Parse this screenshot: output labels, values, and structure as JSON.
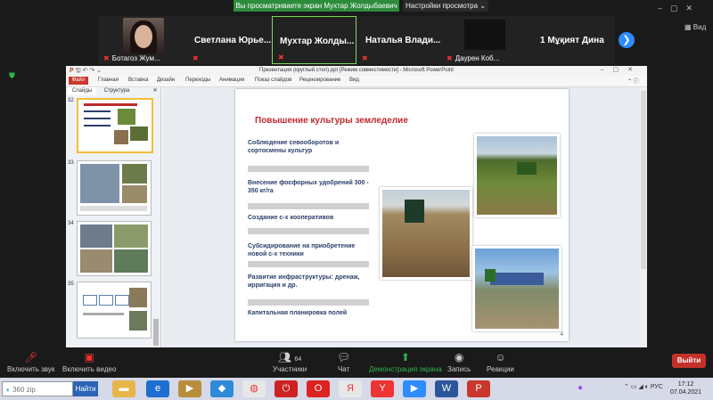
{
  "zoom_top": {
    "share_notice": "Вы просматриваете экран Мухтар Жолдыбаевич",
    "view_options": "Настройки просмотра",
    "view_mode": "Вид"
  },
  "participants": [
    {
      "name": "Ботагоз Жум..."
    },
    {
      "name": "Светлана  Юрье..."
    },
    {
      "name": "Мухтар  Жолды..."
    },
    {
      "name": "Наталья  Влади..."
    },
    {
      "name": "Даурен Коб..."
    },
    {
      "name": "1 Мұқият Дина"
    }
  ],
  "ppt": {
    "window_title": "Презентация (круглый стол).ppt [Режим совместимости] - Microsoft PowerPoint",
    "tabs": [
      "Файл",
      "Главная",
      "Вставка",
      "Дизайн",
      "Переходы",
      "Анимация",
      "Показ слайдов",
      "Рецензирование",
      "Вид"
    ],
    "pane_tabs": [
      "Слайды",
      "Структура"
    ],
    "thumb_numbers": [
      "32",
      "33",
      "34",
      "35"
    ]
  },
  "slide": {
    "title": "Повышение культуры земледелие",
    "items": [
      "Соблюдение севооборотов и сортосмены культур",
      "Внесение фосфорных удобрений 300 - 350 кг/га",
      "Создание с-х кооперативов",
      "Субсидирование  на  приобретение новой  с-х техники",
      "Развитие инфраструктуры: дренаж, ирригация  и др.",
      "Капитальная планировка  полей"
    ],
    "number": "4"
  },
  "controls": {
    "audio": "Включить звук",
    "video": "Включить видео",
    "participants": "Участники",
    "participants_count": "64",
    "chat": "Чат",
    "share": "Демонстрация экрана",
    "record": "Запись",
    "reactions": "Реакции",
    "leave": "Выйти"
  },
  "taskbar": {
    "search_placeholder": "360 zip",
    "search_button": "Найти",
    "lang": "РУС",
    "time": "17:12",
    "date": "07.04.2021"
  }
}
